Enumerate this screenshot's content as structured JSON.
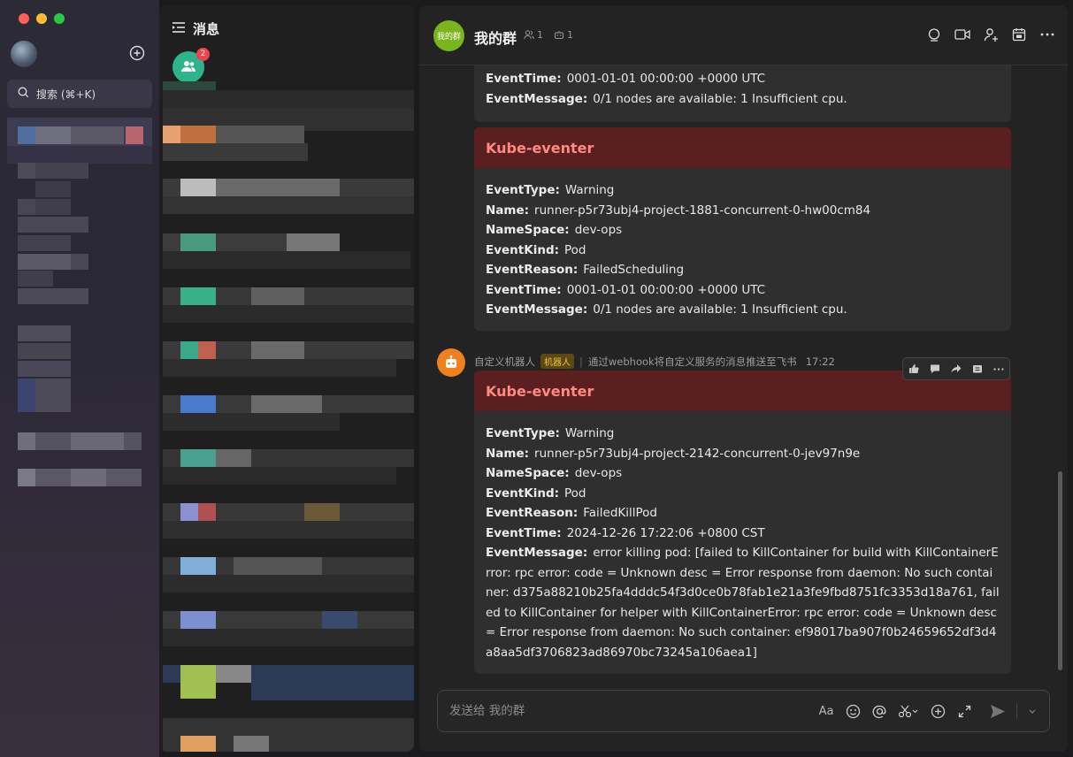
{
  "sidebar": {
    "search_placeholder": "搜索 (⌘+K)"
  },
  "message_list": {
    "title": "消息",
    "group_unread": "2"
  },
  "chat": {
    "avatar_text": "我的群",
    "title": "我的群",
    "member_count": "1",
    "bot_count": "1",
    "top_card": {
      "rows": [
        {
          "key": "EventTime:",
          "value": "0001-01-01 00:00:00 +0000 UTC"
        },
        {
          "key": "EventMessage:",
          "value": "0/1 nodes are available: 1 Insufficient cpu."
        }
      ]
    },
    "card1": {
      "title": "Kube-eventer",
      "rows": [
        {
          "key": "EventType:",
          "value": "Warning"
        },
        {
          "key": "Name:",
          "value": "runner-p5r73ubj4-project-1881-concurrent-0-hw00cm84"
        },
        {
          "key": "NameSpace:",
          "value": "dev-ops"
        },
        {
          "key": "EventKind:",
          "value": "Pod"
        },
        {
          "key": "EventReason:",
          "value": "FailedScheduling"
        },
        {
          "key": "EventTime:",
          "value": "0001-01-01 00:00:00 +0000 UTC"
        },
        {
          "key": "EventMessage:",
          "value": "0/1 nodes are available: 1 Insufficient cpu."
        }
      ]
    },
    "sender": {
      "name": "自定义机器人",
      "tag": "机器人",
      "description": "通过webhook将自定义服务的消息推送至飞书",
      "time": "17:22"
    },
    "card2": {
      "title": "Kube-eventer",
      "rows": [
        {
          "key": "EventType:",
          "value": "Warning"
        },
        {
          "key": "Name:",
          "value": "runner-p5r73ubj4-project-2142-concurrent-0-jev97n9e"
        },
        {
          "key": "NameSpace:",
          "value": "dev-ops"
        },
        {
          "key": "EventKind:",
          "value": "Pod"
        },
        {
          "key": "EventReason:",
          "value": "FailedKillPod"
        },
        {
          "key": "EventTime:",
          "value": "2024-12-26 17:22:06 +0800 CST"
        },
        {
          "key": "EventMessage:",
          "value": "error killing pod: [failed to KillContainer for build with KillContainerError: rpc error: code = Unknown desc = Error response from daemon: No such container: d375a88210b25fa4dddc54f3d0ce0b78fab1e21a3fe9fbd8751fc3353d18a761, failed to KillContainer for helper with KillContainerError: rpc error: code = Unknown desc = Error response from daemon: No such container: ef98017ba907f0b24659652df3d4a8aa5df3706823ad86970bc73245a106aea1]"
        }
      ]
    },
    "composer_placeholder": "发送给 我的群",
    "composer_font_icon": "Aa"
  },
  "colors": {
    "card_header": "#5a1f1e",
    "card_title": "#ff8a80",
    "group_avatar": "#7ab51d",
    "bot_avatar": "#f07f1e",
    "unread_badge": "#f0424d"
  }
}
